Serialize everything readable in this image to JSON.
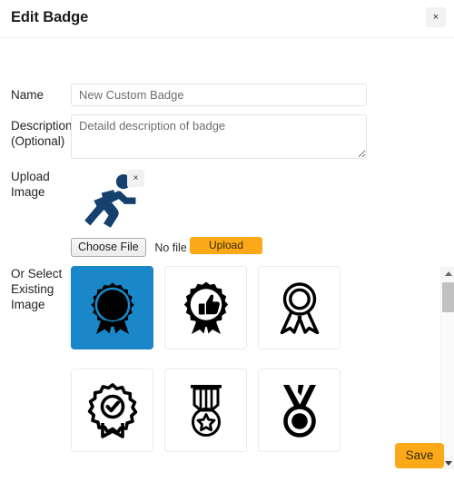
{
  "modal": {
    "title": "Edit Badge",
    "close_label": "×"
  },
  "form": {
    "name": {
      "label": "Name",
      "value": "New Custom Badge",
      "placeholder": "New Custom Badge"
    },
    "description": {
      "label": "Description (Optional)",
      "label_line1": "Description",
      "label_line2": "(Optional)",
      "value": "Detaild description of badge",
      "placeholder": "Detaild description of badge"
    },
    "upload": {
      "label": "Upload Image",
      "label_line1": "Upload",
      "label_line2": "Image",
      "remove_label": "×",
      "choose_file_label": "Choose File",
      "file_status": "No file chosen",
      "upload_button_label": "Upload",
      "preview_icon": "running-person-icon",
      "preview_color": "#16406e"
    },
    "select_existing": {
      "label": "Or Select Existing Image",
      "label_line1": "Or Select",
      "label_line2": "Existing",
      "label_line3": "Image",
      "selected_index": 0,
      "badges": [
        {
          "name": "rosette-ribbon-solid-icon",
          "selected": true
        },
        {
          "name": "thumbs-up-rosette-icon",
          "selected": false
        },
        {
          "name": "award-ribbon-outline-icon",
          "selected": false
        },
        {
          "name": "rosette-check-icon",
          "selected": false
        },
        {
          "name": "medal-star-icon",
          "selected": false
        },
        {
          "name": "medal-circle-icon",
          "selected": false
        }
      ]
    }
  },
  "scrollbar": {
    "up_arrow": "scroll-up-arrow-icon",
    "down_arrow": "scroll-down-arrow-icon"
  },
  "footer": {
    "save_label": "Save"
  },
  "colors": {
    "accent_orange": "#fba919",
    "selection_blue": "#1a87c8",
    "preview_navy": "#16406e"
  }
}
